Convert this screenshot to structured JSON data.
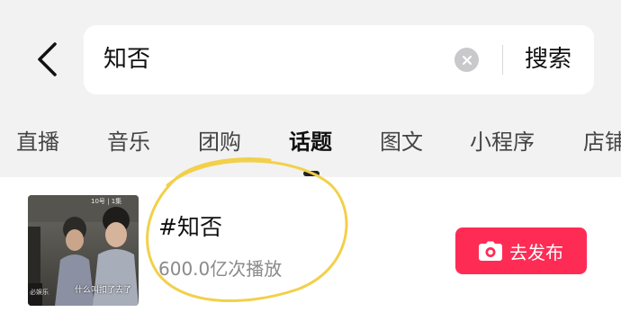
{
  "search": {
    "query": "知否",
    "submit_label": "搜索"
  },
  "tabs": [
    {
      "label": "直播"
    },
    {
      "label": "音乐"
    },
    {
      "label": "团购"
    },
    {
      "label": "话题",
      "active": true
    },
    {
      "label": "图文"
    },
    {
      "label": "小程序"
    },
    {
      "label": "店铺"
    }
  ],
  "result": {
    "title": "#知否",
    "plays": "600.0亿次播放",
    "publish_label": "去发布",
    "thumbnail_caption": "什么叫扣了去了",
    "thumbnail_tag": "10号 | 1集",
    "thumbnail_watermark": "必娱乐"
  },
  "colors": {
    "accent": "#fe2c55",
    "annotation": "#f2d04a"
  },
  "icons": {
    "back": "chevron-left-icon",
    "clear": "clear-circle-icon",
    "publish": "camera-icon"
  }
}
